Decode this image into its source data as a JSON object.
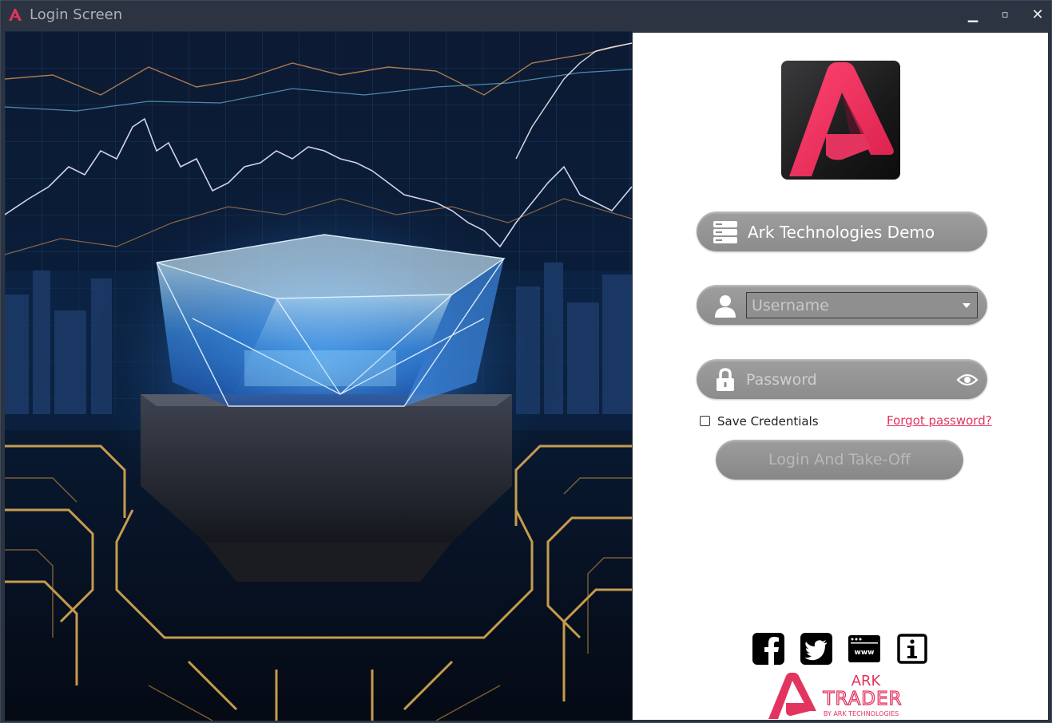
{
  "window": {
    "title": "Login Screen",
    "controls": {
      "minimize": "▁",
      "maximize": "▫",
      "close": "✕"
    }
  },
  "colors": {
    "accent": "#e3345f",
    "pill": "#959595",
    "panel": "#ffffff"
  },
  "login": {
    "server": "Ark Technologies Demo",
    "username_placeholder": "Username",
    "username_value": "",
    "password_placeholder": "Password",
    "save_credentials_label": "Save Credentials",
    "save_credentials_checked": false,
    "forgot_password": "Forgot password?",
    "login_button": "Login And Take-Off"
  },
  "social_icons": [
    "facebook-icon",
    "twitter-icon",
    "website-icon",
    "info-icon"
  ],
  "brand": {
    "line1": "ARK",
    "line2": "TRADER",
    "line3": "BY ARK TECHNOLOGIES"
  }
}
